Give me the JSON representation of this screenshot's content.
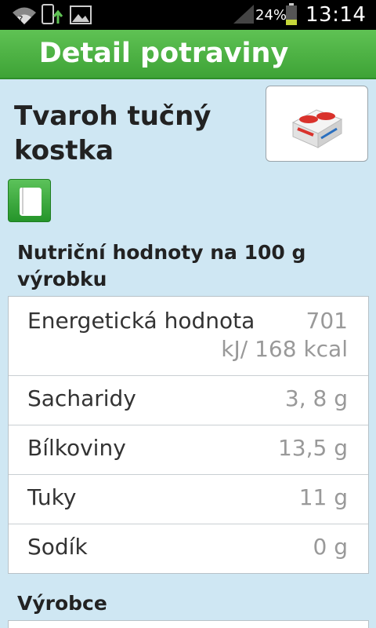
{
  "status_bar": {
    "battery_percent": "24%",
    "time": "13:14",
    "icons": [
      "wifi-icon",
      "upload-icon",
      "image-icon",
      "signal-icon",
      "battery-icon"
    ]
  },
  "action_bar": {
    "title": "Detail potraviny"
  },
  "product": {
    "name_line1": "Tvaroh tučný",
    "name_line2": "kostka"
  },
  "nutrition": {
    "heading_line1": "Nutriční hodnoty na 100 g",
    "heading_line2": "výrobku",
    "rows": [
      {
        "label": "Energetická hodnota",
        "value_line1": "701",
        "value_line2": "kJ/ 168 kcal"
      },
      {
        "label": "Sacharidy",
        "value": "3, 8 g"
      },
      {
        "label": "Bílkoviny",
        "value": "13,5 g"
      },
      {
        "label": "Tuky",
        "value": "11 g"
      },
      {
        "label": "Sodík",
        "value": "0 g"
      }
    ]
  },
  "maker": {
    "heading": "Výrobce"
  },
  "colors": {
    "background": "#cfe7f3",
    "accent_green": "#4cb044",
    "text_dark": "#222222",
    "value_gray": "#999999"
  }
}
